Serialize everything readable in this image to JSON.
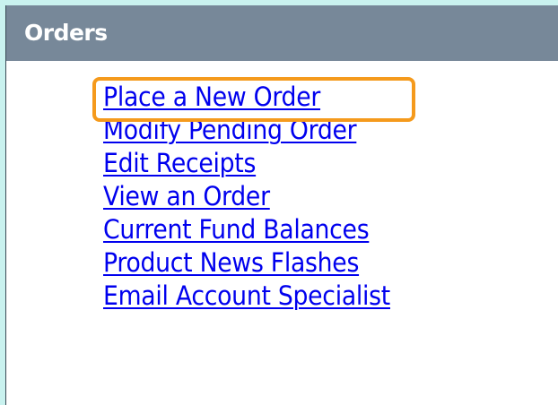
{
  "orders_panel": {
    "title": "Orders",
    "links": [
      {
        "label": "Place a New Order",
        "highlighted": true
      },
      {
        "label": "Modify Pending Order"
      },
      {
        "label": "Edit Receipts"
      },
      {
        "label": "View an Order"
      },
      {
        "label": "Current Fund Balances"
      },
      {
        "label": "Product News Flashes"
      },
      {
        "label": "Email Account Specialist"
      }
    ]
  },
  "colors": {
    "background": "#c9f2ef",
    "header": "#778899",
    "link": "#0000ee",
    "highlight": "#f59a1c"
  }
}
